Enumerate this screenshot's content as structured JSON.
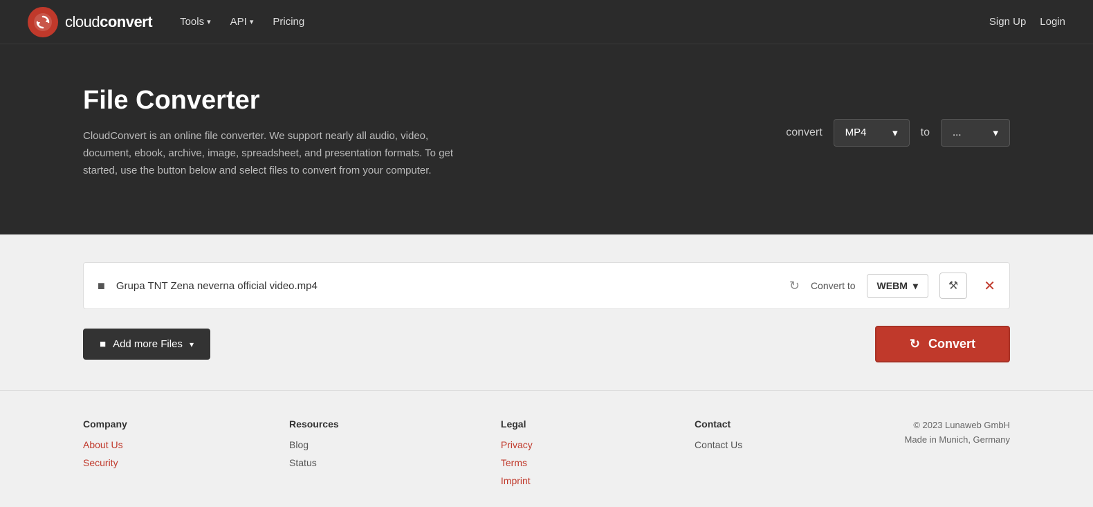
{
  "nav": {
    "logo_text_light": "cloud",
    "logo_text_bold": "convert",
    "tools_label": "Tools",
    "api_label": "API",
    "pricing_label": "Pricing",
    "signup_label": "Sign Up",
    "login_label": "Login"
  },
  "hero": {
    "title": "File Converter",
    "description": "CloudConvert is an online file converter. We support nearly all audio, video, document, ebook, archive, image, spreadsheet, and presentation formats. To get started, use the button below and select files to convert from your computer.",
    "convert_label": "convert",
    "format_from": "MP4",
    "to_label": "to",
    "format_to": "..."
  },
  "converter": {
    "file_name": "Grupa TNT Zena neverna official video.mp4",
    "convert_to_label": "Convert to",
    "format": "WEBM",
    "add_files_label": "Add more Files",
    "convert_button_label": "Convert"
  },
  "footer": {
    "company_heading": "Company",
    "about_us": "About Us",
    "security": "Security",
    "resources_heading": "Resources",
    "blog": "Blog",
    "status": "Status",
    "legal_heading": "Legal",
    "privacy": "Privacy",
    "terms": "Terms",
    "imprint": "Imprint",
    "contact_heading": "Contact",
    "contact_us": "Contact Us",
    "copyright": "© 2023 Lunaweb GmbH",
    "made_in": "Made in Munich, Germany"
  }
}
